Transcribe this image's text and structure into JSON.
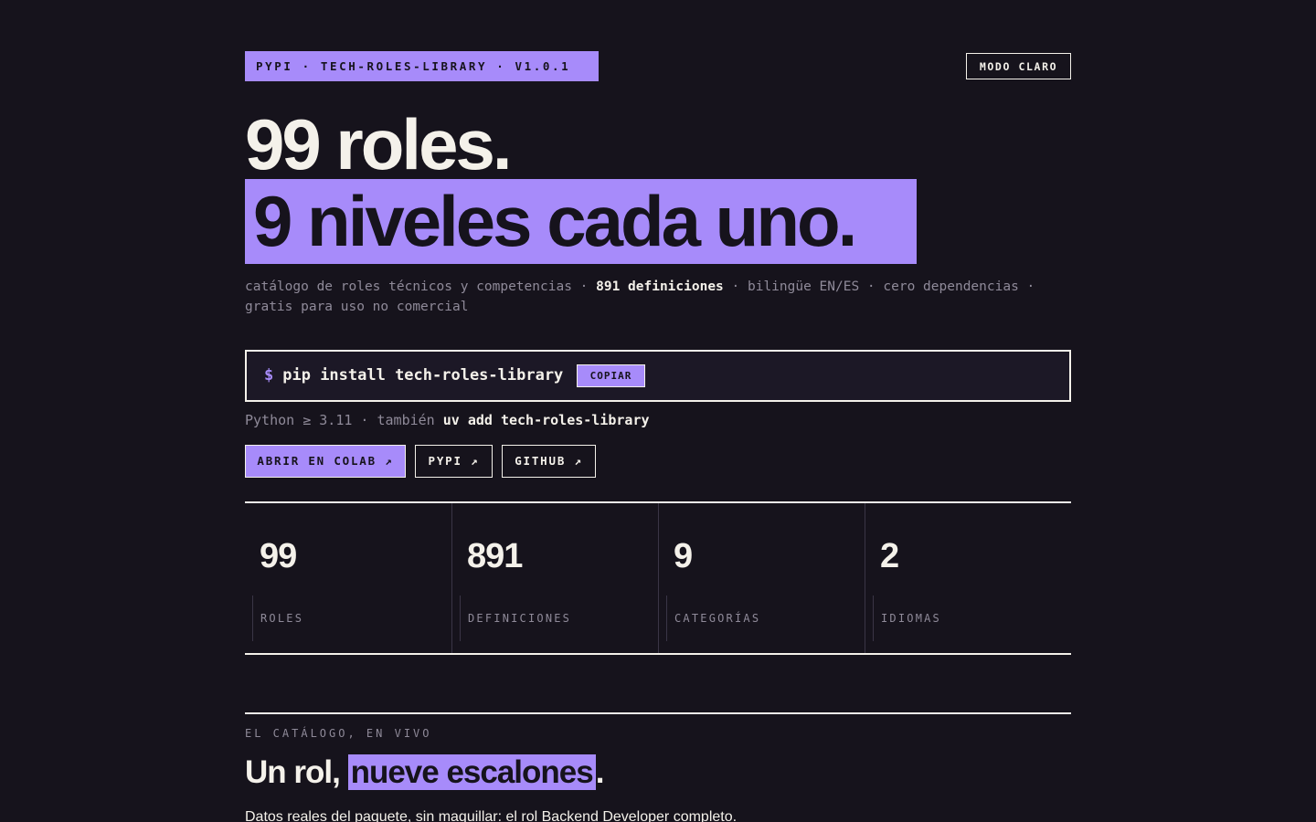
{
  "header": {
    "package_badge": "PYPI · TECH-ROLES-LIBRARY · V1.0.1",
    "mode_toggle_label": "MODO CLARO"
  },
  "hero": {
    "line1": "99 roles.",
    "line2": "9 niveles cada uno."
  },
  "subtitle": {
    "part1": "catálogo de roles técnicos y competencias · ",
    "highlight": "891 definiciones",
    "part2": " · bilingüe EN/ES · cero dependencias · gratis para uso no comercial"
  },
  "install": {
    "prompt": "$",
    "command": "pip install tech-roles-library",
    "copy_label": "COPIAR"
  },
  "requirements": {
    "text": "Python ≥ 3.11 · también ",
    "alt_command": "uv add tech-roles-library"
  },
  "links": [
    {
      "label": "ABRIR EN COLAB ↗"
    },
    {
      "label": "PYPI ↗"
    },
    {
      "label": "GITHUB ↗"
    }
  ],
  "stats": [
    {
      "value": "99",
      "label": "ROLES"
    },
    {
      "value": "891",
      "label": "DEFINICIONES"
    },
    {
      "value": "9",
      "label": "CATEGORÍAS"
    },
    {
      "value": "2",
      "label": "IDIOMAS"
    }
  ],
  "catalog": {
    "eyebrow": "EL CATÁLOGO, EN VIVO",
    "title_start": "Un rol, ",
    "title_highlight": "nueve escalones",
    "title_end": ".",
    "description": "Datos reales del paquete, sin maquillar: el rol Backend Developer completo."
  },
  "colors": {
    "background": "#16131c",
    "accent": "#a78bfa",
    "text": "#f4f1ea",
    "muted": "#8f8a99"
  }
}
